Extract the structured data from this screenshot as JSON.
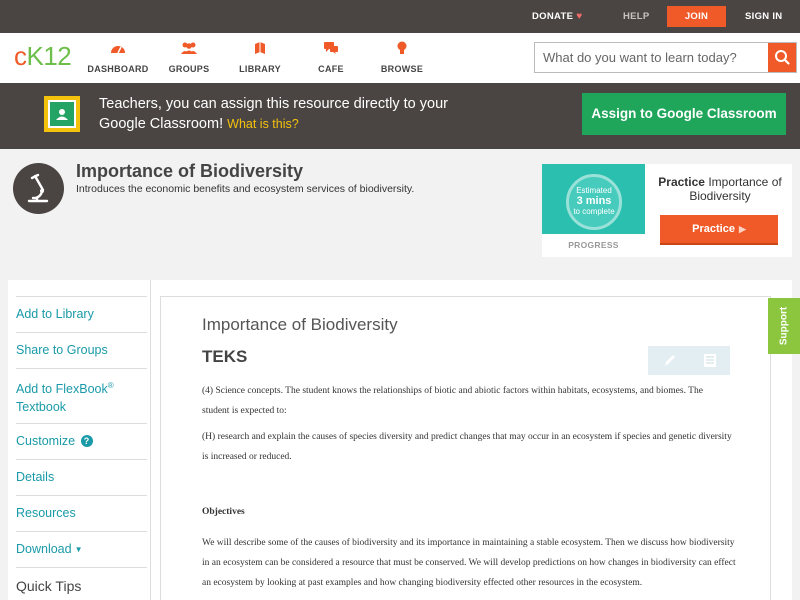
{
  "topbar": {
    "donate": "DONATE",
    "help": "HELP",
    "join": "JOIN",
    "signin": "SIGN IN"
  },
  "header": {
    "logo": {
      "c": "c",
      "k": "K",
      "n": "12"
    },
    "nav": [
      {
        "label": "DASHBOARD",
        "icon": "dashboard-icon"
      },
      {
        "label": "GROUPS",
        "icon": "groups-icon"
      },
      {
        "label": "LIBRARY",
        "icon": "library-icon"
      },
      {
        "label": "CAFE",
        "icon": "cafe-icon"
      },
      {
        "label": "BROWSE",
        "icon": "browse-icon"
      }
    ],
    "search_placeholder": "What do you want to learn today?"
  },
  "banner": {
    "message": "Teachers, you can assign this resource directly to your Google Classroom!",
    "what_link": "What is this?",
    "assign_button": "Assign to Google Classroom"
  },
  "concept": {
    "title": "Importance of Biodiversity",
    "description": "Introduces the economic benefits and ecosystem services of biodiversity."
  },
  "practice": {
    "estimated": "Estimated",
    "mins": "3 mins",
    "to_complete": "to complete",
    "progress_label": "PROGRESS",
    "card_bold": "Practice",
    "card_rest": "Importance of Biodiversity",
    "button": "Practice"
  },
  "sidebar": {
    "add_library": "Add to Library",
    "share_groups": "Share to Groups",
    "add_flexbook": "Add to FlexBook",
    "reg": "®",
    "textbook": "Textbook",
    "customize": "Customize",
    "details": "Details",
    "resources": "Resources",
    "download": "Download",
    "quick_tips": "Quick Tips"
  },
  "content": {
    "title": "Importance of Biodiversity",
    "heading": "TEKS",
    "para1": "(4)  Science concepts. The student knows the relationships of biotic and abiotic factors within habitats, ecosystems, and biomes. The student is expected to:",
    "para2": "(H)  research and explain the causes of species diversity and predict changes that may occur in an ecosystem if species and genetic diversity is increased or reduced.",
    "objectives": "Objectives",
    "para3": "We will describe some of the causes of biodiversity and its importance in maintaining a stable ecosystem.   Then we discuss how biodiversity in an ecosystem can be considered a resource that must be conserved.   We will develop predictions on how changes in biodiversity can effect an ecosystem by looking at past examples and how changing biodiversity effected other resources in the ecosystem."
  },
  "support": "Support",
  "colors": {
    "accent": "#f05a28",
    "brand_green": "#6ebe4a",
    "teal_link": "#1a9aa8",
    "google_green": "#1fa65b"
  }
}
